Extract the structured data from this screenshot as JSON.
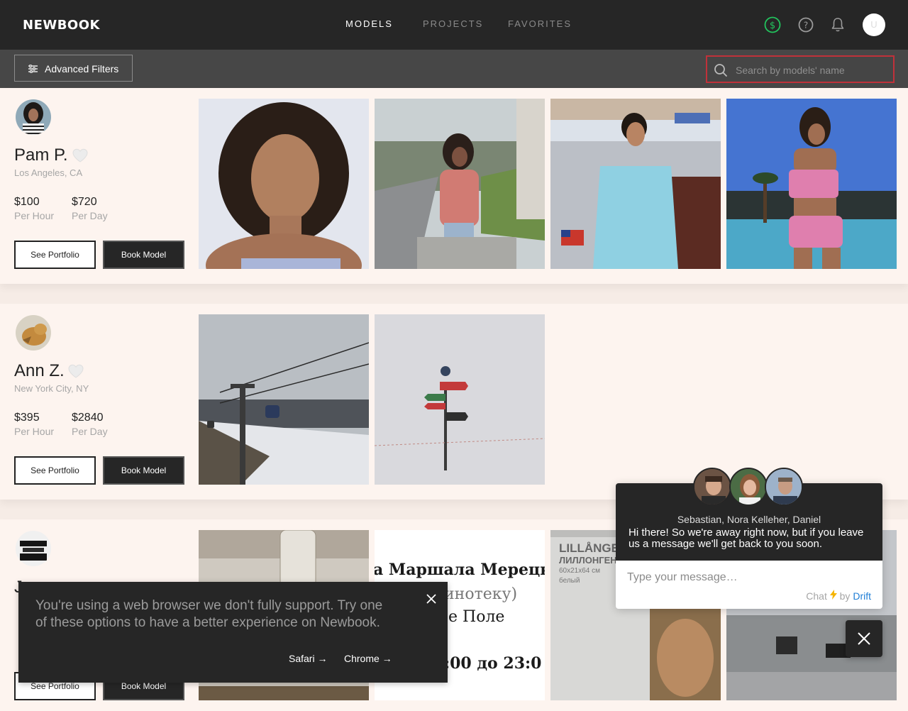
{
  "header": {
    "logo": "NEWBOOK",
    "nav": [
      {
        "label": "MODELS",
        "active": true
      },
      {
        "label": "PROJECTS",
        "active": false
      },
      {
        "label": "FAVORITES",
        "active": false
      }
    ],
    "user_initial": "U",
    "icons": [
      "dollar-icon",
      "help-icon",
      "bell-icon"
    ]
  },
  "filters": {
    "advanced_label": "Advanced Filters",
    "search_placeholder": "Search by models' name",
    "search_value": ""
  },
  "models": [
    {
      "name": "Pam P.",
      "location": "Los Angeles, CA",
      "hour_price": "$100",
      "hour_label": "Per Hour",
      "day_price": "$720",
      "day_label": "Per Day",
      "see_portfolio": "See Portfolio",
      "book_model": "Book Model"
    },
    {
      "name": "Ann Z.",
      "location": "New York City, NY",
      "hour_price": "$395",
      "hour_label": "Per Hour",
      "day_price": "$2840",
      "day_label": "Per Day",
      "see_portfolio": "See Portfolio",
      "book_model": "Book Model"
    },
    {
      "see_portfolio": "See Portfolio",
      "book_model": "Book Model",
      "photo_texts": [
        "а Маршала Мерецк",
        "инотеку)",
        "е Поле",
        ":00 до 23:0",
        "LILLÅNGE",
        "ЛИЛЛОНГЕН",
        "60x21x64 см",
        "белый"
      ]
    }
  ],
  "browser_banner": {
    "message": "You're using a web browser we don't fully support. Try one of these options to have a better experience on Newbook.",
    "links": [
      "Safari →",
      "Chrome →"
    ]
  },
  "chat": {
    "team": "Sebastian, Nora Kelleher, Daniel",
    "message": "Hi there! So we're away right now, but if you leave us a message we'll get back to you soon.",
    "input_placeholder": "Type your message…",
    "brand_prefix": "Chat",
    "brand_by": "by",
    "brand_name": "Drift"
  },
  "colors": {
    "topbar": "#262626",
    "filterbar": "#474747",
    "page_bg": "#f6ece6",
    "card_bg": "#fdf4ef",
    "search_border": "#c0313a",
    "dollar_icon": "#22c35d",
    "drift": "#1f7ed6"
  }
}
